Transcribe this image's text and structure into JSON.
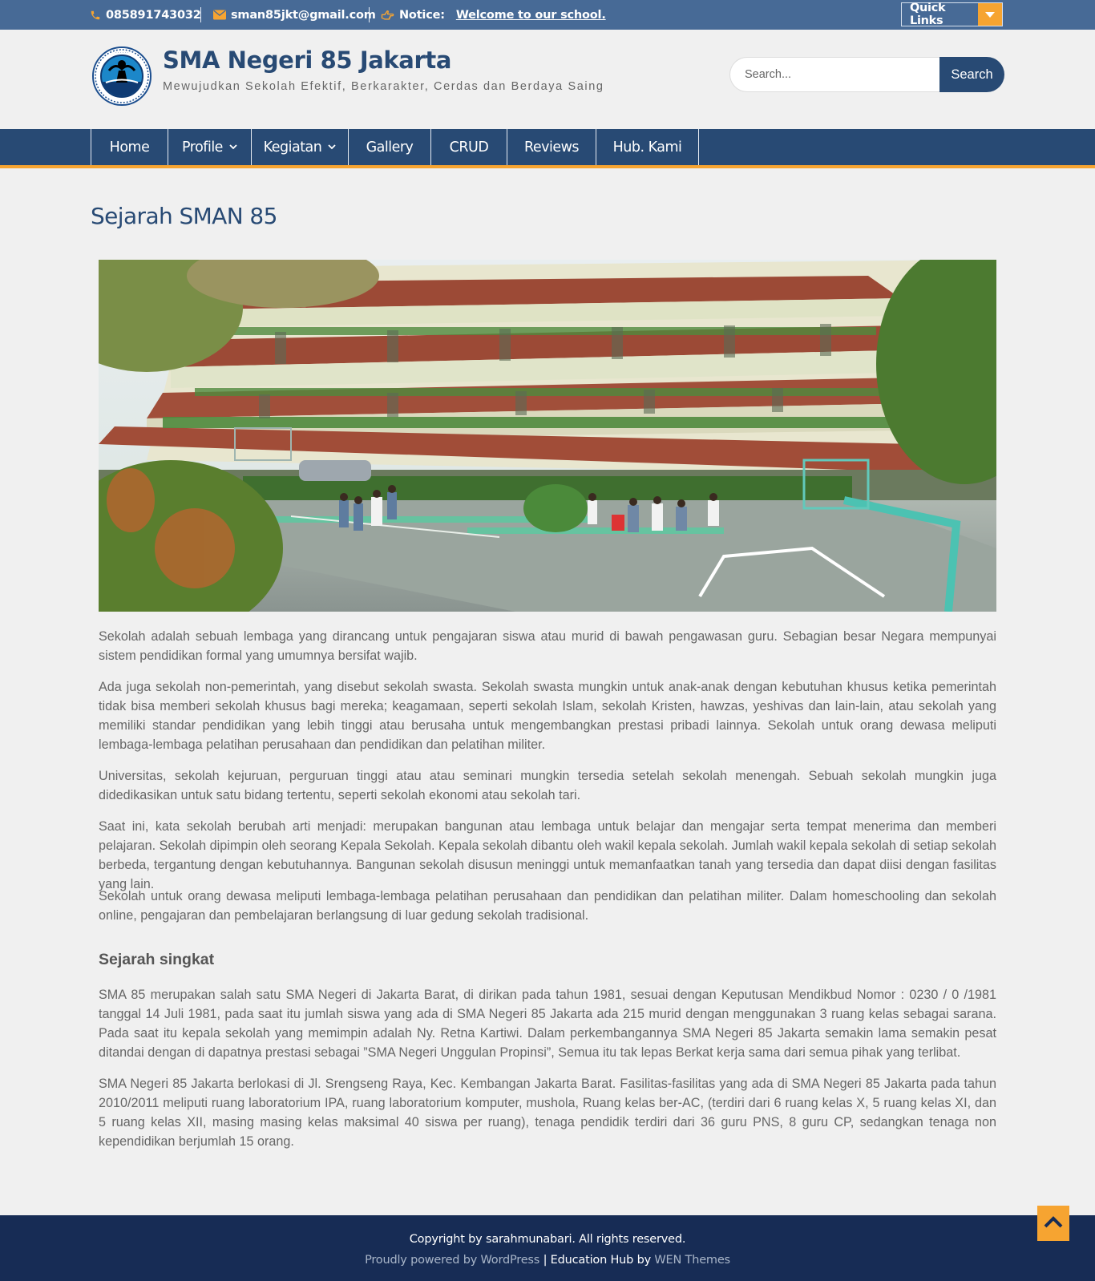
{
  "topbar": {
    "phone": "085891743032",
    "email": "sman85jkt@gmail.com",
    "notice_label": "Notice:",
    "notice_text": "Welcome to our school.",
    "quick_links": "Quick Links",
    "icons": [
      "phone-icon",
      "envelope-icon",
      "hand-point-right-icon",
      "caret-down-icon"
    ]
  },
  "header": {
    "title": "SMA Negeri 85 Jakarta",
    "tagline": "Mewujudkan Sekolah Efektif, Berkarakter, Cerdas dan Berdaya Saing",
    "search_placeholder": "Search...",
    "search_button": "Search"
  },
  "nav": {
    "items": [
      {
        "label": "Home",
        "dropdown": false
      },
      {
        "label": "Profile",
        "dropdown": true
      },
      {
        "label": "Kegiatan",
        "dropdown": true
      },
      {
        "label": "Gallery",
        "dropdown": false
      },
      {
        "label": "CRUD",
        "dropdown": false
      },
      {
        "label": "Reviews",
        "dropdown": false
      },
      {
        "label": "Hub. Kami",
        "dropdown": false
      }
    ]
  },
  "main": {
    "title": "Sejarah SMAN 85",
    "paragraphs": [
      "Sekolah adalah sebuah lembaga yang dirancang untuk pengajaran siswa atau murid di bawah pengawasan guru. Sebagian besar Negara mempunyai sistem pendidikan formal yang umumnya bersifat wajib.",
      "Ada juga sekolah non-pemerintah, yang disebut sekolah swasta. Sekolah swasta mungkin untuk anak-anak dengan kebutuhan khusus ketika pemerintah tidak bisa memberi sekolah khusus bagi mereka; keagamaan, seperti sekolah Islam, sekolah Kristen, hawzas, yeshivas dan lain-lain, atau sekolah yang memiliki standar pendidikan yang lebih tinggi atau berusaha untuk mengembangkan prestasi pribadi lainnya. Sekolah untuk orang dewasa meliputi lembaga-lembaga pelatihan perusahaan dan pendidikan dan pelatihan militer.",
      "Universitas, sekolah kejuruan, perguruan tinggi atau atau seminari mungkin tersedia setelah sekolah menengah. Sebuah sekolah mungkin juga didedikasikan untuk satu bidang tertentu, seperti sekolah ekonomi atau sekolah tari.",
      "Saat ini, kata sekolah berubah arti menjadi: merupakan bangunan atau lembaga untuk belajar dan mengajar serta tempat menerima dan memberi pelajaran. Sekolah dipimpin oleh seorang Kepala Sekolah. Kepala sekolah dibantu oleh wakil kepala sekolah. Jumlah wakil kepala sekolah di setiap sekolah berbeda, tergantung dengan kebutuhannya. Bangunan sekolah disusun meninggi untuk memanfaatkan tanah yang tersedia dan dapat diisi dengan fasilitas yang lain.",
      "Sekolah untuk orang dewasa meliputi lembaga-lembaga pelatihan perusahaan dan pendidikan dan pelatihan militer. Dalam homeschooling dan sekolah online, pengajaran dan pembelajaran berlangsung di luar gedung sekolah tradisional."
    ],
    "subheading": "Sejarah singkat",
    "history": [
      "SMA 85 merupakan salah satu SMA Negeri di Jakarta Barat, di dirikan pada tahun 1981, sesuai dengan Keputusan Mendikbud Nomor : 0230 / 0 /1981 tanggal 14 Juli 1981, pada saat itu jumlah siswa yang ada di SMA Negeri 85 Jakarta ada 215 murid dengan menggunakan 3 ruang kelas sebagai sarana. Pada saat itu kepala sekolah yang memimpin adalah Ny. Retna Kartiwi. Dalam perkembangannya SMA Negeri 85 Jakarta semakin lama semakin pesat ditandai dengan di dapatnya prestasi sebagai ”SMA Negeri Unggulan Propinsi”, Semua itu tak lepas Berkat kerja sama dari semua pihak yang terlibat.",
      "SMA Negeri 85 Jakarta berlokasi di Jl. Srengseng Raya, Kec. Kembangan Jakarta Barat. Fasilitas-fasilitas yang ada di SMA Negeri 85 Jakarta pada tahun 2010/2011 meliputi ruang laboratorium IPA, ruang laboratorium komputer, mushola, Ruang kelas ber-AC, (terdiri dari 6 ruang kelas X, 5 ruang kelas XI, dan 5 ruang kelas XII, masing masing kelas maksimal 40 siswa per ruang), tenaga pendidik terdiri dari 36 guru PNS, 8 guru CP, sedangkan tenaga non kependidikan berjumlah 15 orang."
    ]
  },
  "footer": {
    "copyright": "Copyright by sarahmunabari. All rights reserved.",
    "powered": "Proudly powered by WordPress",
    "sep": "|",
    "theme_prefix": "Education Hub by",
    "theme_link": "WEN Themes"
  },
  "colors": {
    "topbar": "#476a96",
    "primary": "#284a74",
    "accent": "#f6a431",
    "footer": "#172c55",
    "background": "#f0f0f0"
  }
}
